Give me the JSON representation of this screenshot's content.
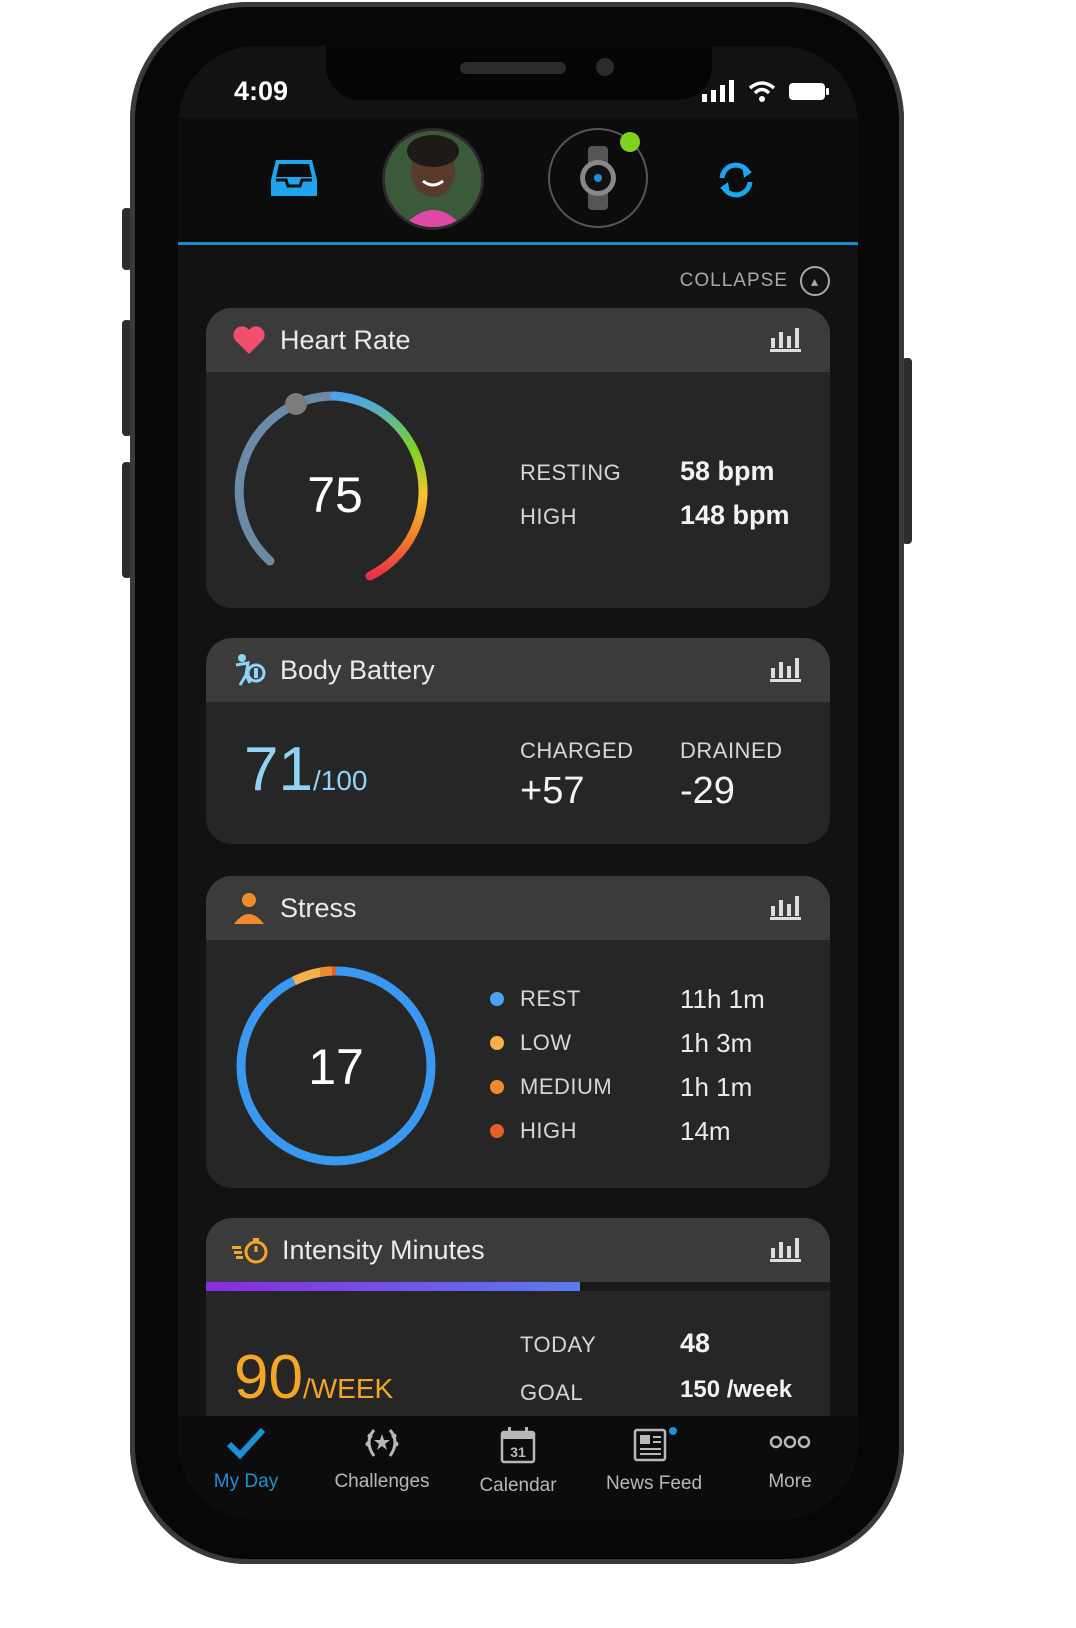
{
  "status_bar": {
    "time": "4:09"
  },
  "header": {
    "collapse_label": "COLLAPSE"
  },
  "heart_rate": {
    "title": "Heart Rate",
    "current": "75",
    "resting_label": "RESTING",
    "resting_value": "58 bpm",
    "high_label": "HIGH",
    "high_value": "148 bpm"
  },
  "body_battery": {
    "title": "Body Battery",
    "value": "71",
    "max": "/100",
    "charged_label": "CHARGED",
    "charged_value": "+57",
    "drained_label": "DRAINED",
    "drained_value": "-29"
  },
  "stress": {
    "title": "Stress",
    "current": "17",
    "levels": [
      {
        "label": "REST",
        "value": "11h 1m",
        "color": "#4aa3ee"
      },
      {
        "label": "LOW",
        "value": "1h 3m",
        "color": "#f6b04a"
      },
      {
        "label": "MEDIUM",
        "value": "1h 1m",
        "color": "#f08a2a"
      },
      {
        "label": "HIGH",
        "value": "14m",
        "color": "#e4602a"
      }
    ]
  },
  "intensity": {
    "title": "Intensity Minutes",
    "value": "90",
    "unit": "/WEEK",
    "progress_fraction": 0.6,
    "today_label": "TODAY",
    "today_value": "48",
    "goal_label": "GOAL",
    "goal_value": "150 /week"
  },
  "tabs": [
    {
      "label": "My Day",
      "icon": "check-icon",
      "active": true
    },
    {
      "label": "Challenges",
      "icon": "laurel-icon",
      "active": false
    },
    {
      "label": "Calendar",
      "icon": "calendar-icon",
      "active": false,
      "calendar_day": "31"
    },
    {
      "label": "News Feed",
      "icon": "newspaper-icon",
      "active": false
    },
    {
      "label": "More",
      "icon": "more-dots-icon",
      "active": false
    }
  ],
  "colors": {
    "accent": "#1e90d8",
    "heart": "#f0506e",
    "battery": "#8fd4f5",
    "intensity": "#f4a724"
  }
}
